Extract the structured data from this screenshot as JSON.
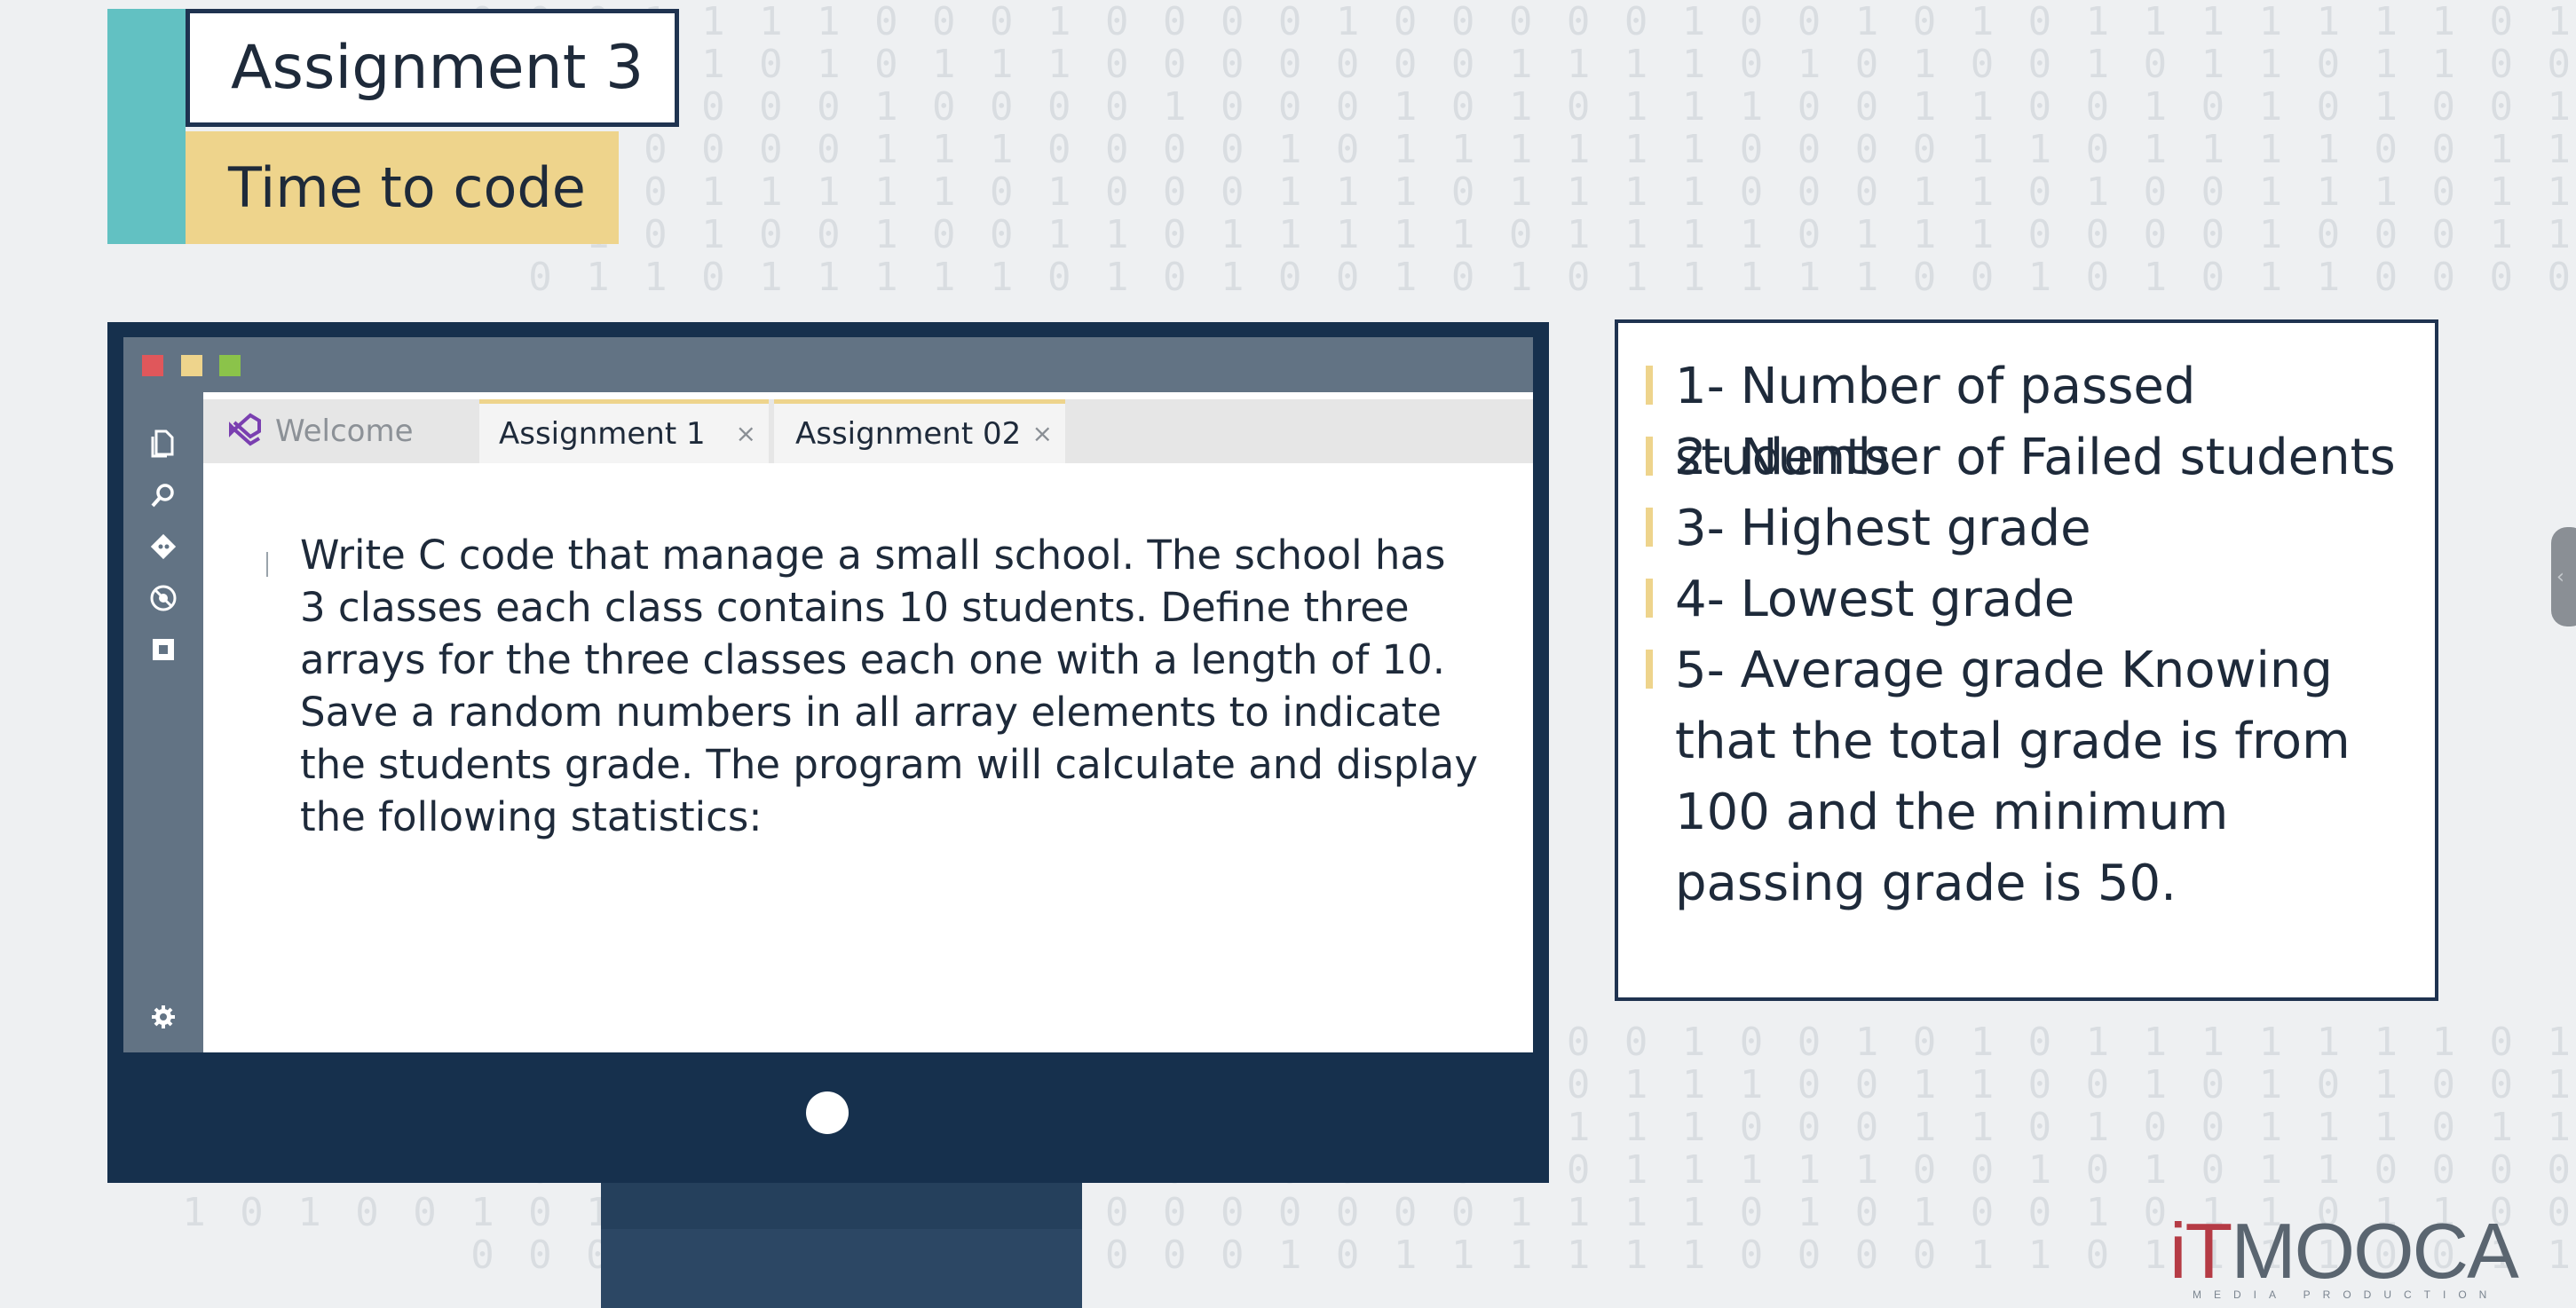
{
  "header": {
    "title": "Assignment 3",
    "subtitle": "Time to code"
  },
  "background": {
    "binary_rows": [
      "0 0 0 1 1 1 1 0 0 0 1 0 0 0 0 1 0 0 0 0 0 1 0 0 1 0 1 0 1 1 1 1 1 1 1 0 1",
      "1 0 1 0 0 1 0 1 0 1 0 1 0 1 1 1 0 0 0 0 0 0 0 1 1 1 1 0 1 0 1 0 0 1 0 1 1 0 1 1 0 0",
      "0 0 0 0 0 0 0 1 0 0 0 0 1 0 0 0 1 0 1 0 1 1 1 0 0 1 1 0 0 1 0 1 0 1 0 0 1",
      "0 0 0 0 0 0 0 1 1 1 0 0 0 0 1 0 1 1 1 1 1 1 0 0 0 0 1 1 0 1 1 1 1 0 0 1 1",
      "0 1 0 1 0 1 0 0 0 1 1 1 1 1 0 1 0 0 0 1 1 1 0 1 1 1 1 0 0 0 1 1 0 1 0 0 1 1 1 0 1 1",
      "1 0 1 0 0 1 0 0 1 1 0 1 1 1 1 1 0 1 1 1 1 0 1 1 1 0 0 0 0 1 0 0 0 1 1",
      "0 1 1 0 1 1 1 1 1 0 1 0 1 0 0 1 0 1 0 1 1 1 1 1 0 0 1 0 1 0 1 1 0 0 0 0"
    ]
  },
  "editor": {
    "window_dots": [
      "#e0575b",
      "#eed48c",
      "#8bc34a"
    ],
    "activity_icons": [
      "files-icon",
      "search-icon",
      "git-icon",
      "debug-icon",
      "extensions-icon",
      "settings-gear-icon"
    ],
    "tabs": [
      {
        "label": "Welcome"
      },
      {
        "label": "Assignment 1",
        "close": "×"
      },
      {
        "label": "Assignment 02",
        "close": "×"
      }
    ],
    "content": "Write C code that manage a small school. The school has 3 classes each class contains 10 students. Define three arrays for the three classes each one with a length of 10. Save a random numbers in all array elements to indicate the students grade. The program will calculate and display the following statistics:"
  },
  "statistics": {
    "items": [
      "1- Number of passed students",
      "2- Number of Failed students",
      "3- Highest grade",
      "4- Lowest grade",
      "5- Average grade Knowing that the total grade is from 100 and the minimum passing grade is 50."
    ]
  },
  "logo": {
    "prefix": "iT",
    "name": "MOOCA",
    "tagline": "MEDIA PRODUCTION"
  },
  "colors": {
    "teal": "#62c1c2",
    "yellow": "#eed48c",
    "navy": "#16304d",
    "slate": "#627384"
  }
}
